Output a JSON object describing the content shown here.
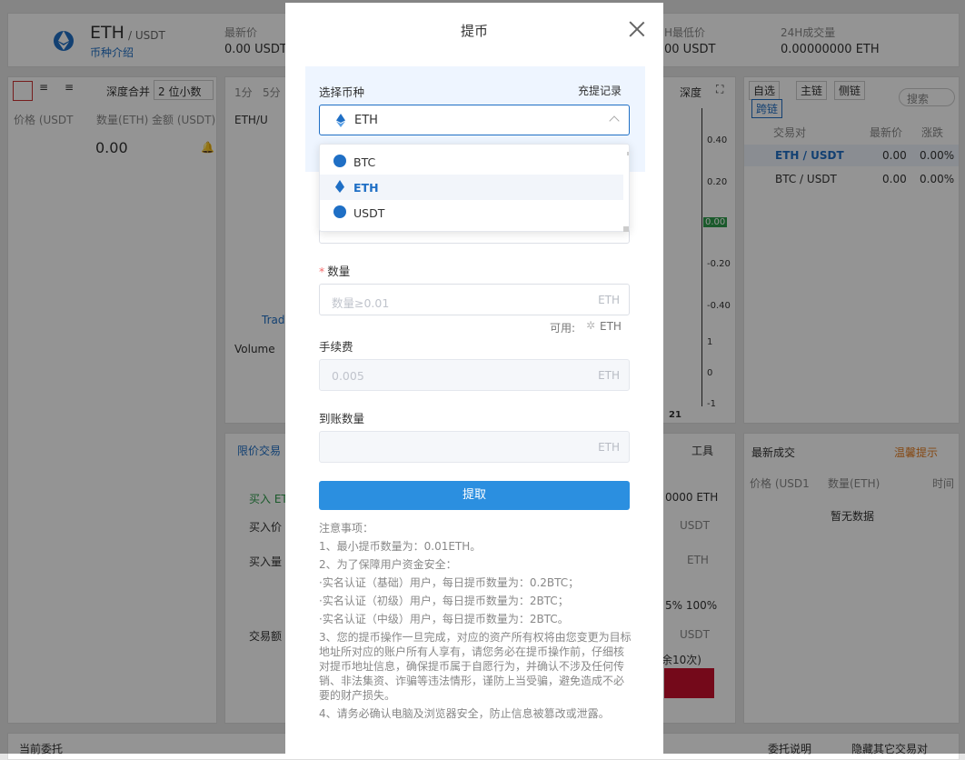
{
  "background": {
    "pair_base": "ETH",
    "pair_quote": "/ USDT",
    "coin_intro": "币种介绍",
    "latest_price_label": "最新价",
    "latest_price_value": "0.00 USDT",
    "low24_label": "H最低价",
    "low24_value": "00 USDT",
    "vol24_label": "24H成交量",
    "vol24_value": "0.00000000 ETH",
    "depth_merge_label": "深度合并",
    "depth_merge_value": "2 位小数",
    "ob_col_price": "价格 (USDT",
    "ob_col_amount": "数量(ETH)",
    "ob_col_total": "金额 (USDT)",
    "ob_mid_price": "0.00",
    "chart_tabs": [
      "1分",
      "5分"
    ],
    "chart_depth": "深度",
    "chart_pair": "ETH/U",
    "chart_volume": "Volume",
    "chart_brand": "Trad",
    "yaxis": [
      "0.40",
      "0.20",
      "0.00",
      "-0.20",
      "-0.40",
      "1",
      "0",
      "-1"
    ],
    "xaxis_tick": "21",
    "watch_tabs": [
      "自选",
      "主链",
      "侧链",
      "跨链"
    ],
    "search_placeholder": "搜索",
    "market_cols": [
      "交易对",
      "最新价",
      "涨跌"
    ],
    "markets": [
      {
        "pair": "ETH / USDT",
        "price": "0.00",
        "change": "0.00%"
      },
      {
        "pair": "BTC / USDT",
        "price": "0.00",
        "change": "0.00%"
      }
    ],
    "trades_title": "最新成交",
    "trades_tip": "温馨提示",
    "trades_cols": [
      "价格 (USD1",
      "数量(ETH)",
      "时间"
    ],
    "trades_empty": "暂无数据",
    "order_tab": "限价交易",
    "tools": "工具",
    "buy_label": "买入 ET",
    "buy_price": "买入价",
    "buy_amount": "买入量",
    "trade_total": "交易额",
    "right_balance": "0000 ETH",
    "unit_usdt": "USDT",
    "unit_eth": "ETH",
    "pct": "5% 100%",
    "remaining": "余10次)",
    "current_orders": "当前委托",
    "order_help": "委托说明",
    "hide_others": "隐藏其它交易对"
  },
  "modal": {
    "title": "提币",
    "select_coin_label": "选择币种",
    "history_link": "充提记录",
    "selected_coin": "ETH",
    "options": [
      "BTC",
      "ETH",
      "USDT"
    ],
    "amount_label": "数量",
    "amount_placeholder": "数量≥0.01",
    "amount_unit": "ETH",
    "available_label": "可用:",
    "available_unit": "ETH",
    "fee_label": "手续费",
    "fee_value": "0.005",
    "fee_unit": "ETH",
    "receive_label": "到账数量",
    "receive_unit": "ETH",
    "submit": "提取",
    "notes": [
      "注意事项：",
      "1、最小提币数量为：0.01ETH。",
      "2、为了保障用户资金安全：",
      "·实名认证（基础）用户，每日提币数量为：0.2BTC；",
      "·实名认证（初级）用户，每日提币数量为：2BTC；",
      "·实名认证（中级）用户，每日提币数量为：2BTC。",
      "3、您的提币操作一旦完成，对应的资产所有权将由您变更为目标地址所对应的账户所有人享有，请您务必在提币操作前，仔细核对提币地址信息，确保提币属于自愿行为，并确认不涉及任何传销、非法集资、诈骗等违法情形，谨防上当受骗，避免造成不必要的财产损失。",
      "4、请务必确认电脑及浏览器安全，防止信息被篡改或泄露。"
    ]
  },
  "colors": {
    "accent": "#2b8fe0",
    "link": "#1f6fc5",
    "required": "#f56c6c",
    "sell": "#c8102e",
    "green": "#2e9b4b"
  }
}
